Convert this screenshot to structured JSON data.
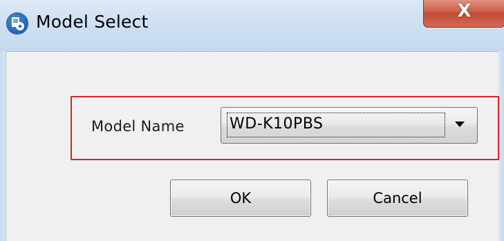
{
  "window": {
    "title": "Model Select",
    "close_glyph": "X"
  },
  "icons": {
    "app": "app-gear-icon",
    "close": "close-icon",
    "dropdown": "chevron-down-icon"
  },
  "form": {
    "model_name_label": "Model Name",
    "model_name_value": "WD-K10PBS"
  },
  "buttons": {
    "ok_label": "OK",
    "cancel_label": "Cancel"
  },
  "colors": {
    "highlight_border": "#d9232e",
    "titlebar": "#cfe0f3",
    "close_button": "#c24a33",
    "client_background": "#f0f0f0"
  }
}
